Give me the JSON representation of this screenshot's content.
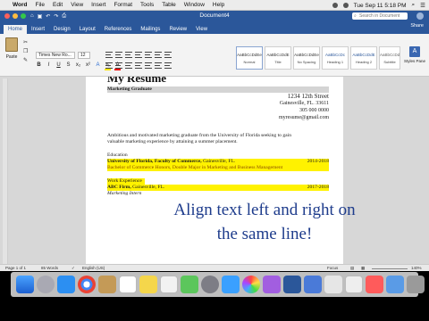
{
  "menubar": {
    "items": [
      "Word",
      "File",
      "Edit",
      "View",
      "Insert",
      "Format",
      "Tools",
      "Table",
      "Window",
      "Help"
    ],
    "clock": "Tue Sep 11  5:18 PM"
  },
  "window": {
    "title": "Document4",
    "search_placeholder": "Search in Document",
    "tabs": [
      "Home",
      "Insert",
      "Design",
      "Layout",
      "References",
      "Mailings",
      "Review",
      "View"
    ],
    "share_label": "Share"
  },
  "ribbon": {
    "paste_label": "Paste",
    "font_name": "Times New Ro...",
    "font_size": "12",
    "styles": [
      {
        "preview": "AaBbCcDdEe",
        "name": "Normal"
      },
      {
        "preview": "AaBbCcDdE",
        "name": "Title"
      },
      {
        "preview": "AaBbCcDdEe",
        "name": "No Spacing"
      },
      {
        "preview": "AaBbCcDc",
        "name": "Heading 1"
      },
      {
        "preview": "AaBbCcDdE",
        "name": "Heading 2"
      },
      {
        "preview": "AaBbCcDdEe",
        "name": "Subtitle"
      },
      {
        "preview": "AaBbCcDdE",
        "name": "Subtle Emph..."
      }
    ],
    "styles_pane_label": "Styles Pane"
  },
  "document": {
    "title": "My Resume",
    "subtitle": "Marketing Graduate",
    "address": [
      "1234 12th Street",
      "Gainesville, FL. 33611",
      "305 000 0000",
      "myresume@gmail.com"
    ],
    "objective_1": "Ambitious and motivated marketing graduate from the University of Florida seeking to gain",
    "objective_2": "valuable marketing experience by attaining a summer placement.",
    "education_heading": "Education",
    "education_school": "University of Florida, Faculty of Commerce,",
    "education_city": " Gainesville, FL.",
    "education_dates": "2014-2018",
    "education_degree": "Bachelor of Commerce Honors, Double Major in Marketing and Business Management",
    "work_heading": "Work Experience",
    "work_company": "ABC Firm,",
    "work_city": " Gainesville, FL.",
    "work_dates": "2017-2018",
    "work_role": "Marketing Intern"
  },
  "overlay": {
    "line1": "Align text left and right on",
    "line2": "the same line!"
  },
  "status": {
    "page": "Page 1 of 1",
    "words": "85 Words",
    "language": "English (US)",
    "focus": "Focus",
    "zoom": "140%"
  }
}
